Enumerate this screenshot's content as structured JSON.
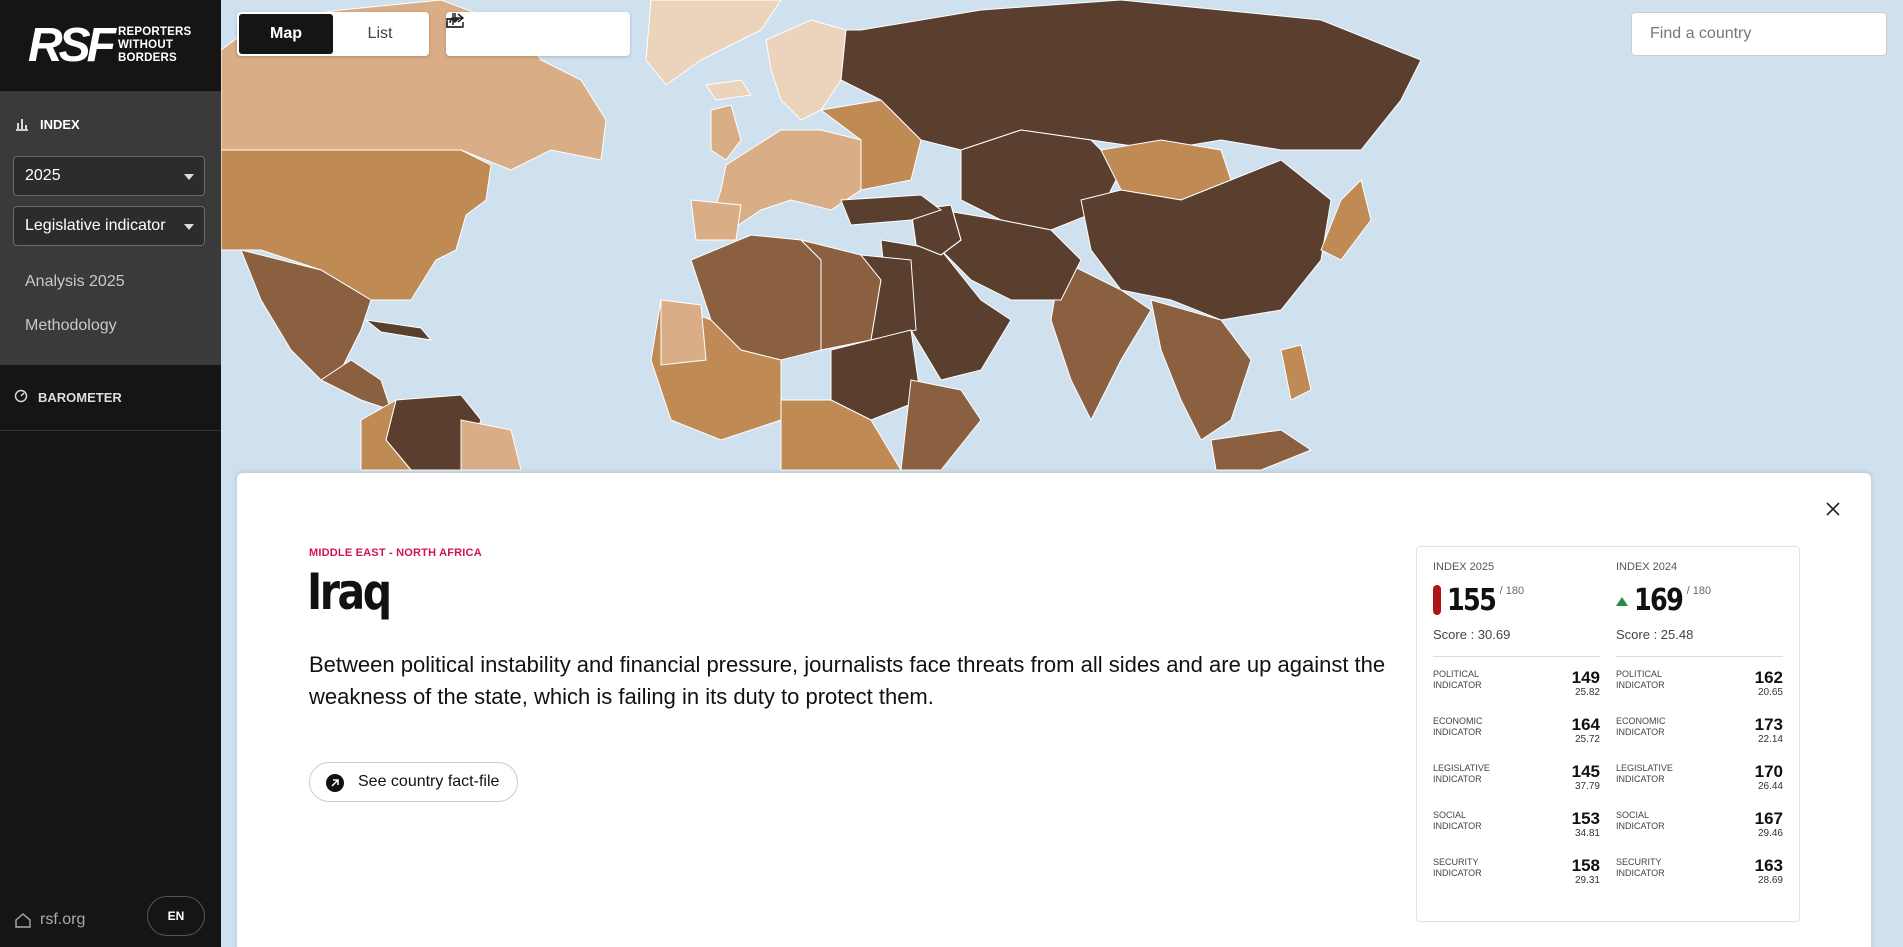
{
  "sidebar": {
    "logo_mark": "RSF",
    "logo_line1": "REPORTERS",
    "logo_line2": "WITHOUT BORDERS",
    "index_label": "INDEX",
    "year_select": "2025",
    "indicator_select": "Legislative indicator",
    "links": [
      "Analysis 2025",
      "Methodology"
    ],
    "barometer_label": "BAROMETER",
    "site_link": "rsf.org",
    "language": "EN"
  },
  "toolbar": {
    "map_label": "Map",
    "list_label": "List",
    "active_view": "Map",
    "tools": [
      "zoom-in-icon",
      "zoom-out-icon",
      "download-icon",
      "share-icon"
    ]
  },
  "search": {
    "placeholder": "Find a country"
  },
  "colors": {
    "ocean": "#cfe0ee",
    "very_serious": "#5a3f2e",
    "difficult": "#8a6040",
    "problematic": "#c08a55",
    "satisfactory": "#d9ad85",
    "good": "#ecd3bb",
    "accent_red": "#d0144f"
  },
  "country": {
    "region": "MIDDLE EAST - NORTH AFRICA",
    "name": "Iraq",
    "description": "Between political instability and financial pressure, journalists face threats from all sides and are up against the weakness of the state, which is failing in its duty to protect them.",
    "factfile_label": "See country fact-file"
  },
  "scorecard": [
    {
      "title": "INDEX 2025",
      "rank": "155",
      "of": "/ 180",
      "trend": "red-bar",
      "score": "Score : 30.69",
      "indicators": [
        {
          "label1": "POLITICAL",
          "label2": "INDICATOR",
          "rank": "149",
          "score": "25.82"
        },
        {
          "label1": "ECONOMIC",
          "label2": "INDICATOR",
          "rank": "164",
          "score": "25.72"
        },
        {
          "label1": "LEGISLATIVE",
          "label2": "INDICATOR",
          "rank": "145",
          "score": "37.79"
        },
        {
          "label1": "SOCIAL",
          "label2": "INDICATOR",
          "rank": "153",
          "score": "34.81"
        },
        {
          "label1": "SECURITY",
          "label2": "INDICATOR",
          "rank": "158",
          "score": "29.31"
        }
      ]
    },
    {
      "title": "INDEX 2024",
      "rank": "169",
      "of": "/ 180",
      "trend": "up-arrow",
      "score": "Score : 25.48",
      "indicators": [
        {
          "label1": "POLITICAL",
          "label2": "INDICATOR",
          "rank": "162",
          "score": "20.65"
        },
        {
          "label1": "ECONOMIC",
          "label2": "INDICATOR",
          "rank": "173",
          "score": "22.14"
        },
        {
          "label1": "LEGISLATIVE",
          "label2": "INDICATOR",
          "rank": "170",
          "score": "26.44"
        },
        {
          "label1": "SOCIAL",
          "label2": "INDICATOR",
          "rank": "167",
          "score": "29.46"
        },
        {
          "label1": "SECURITY",
          "label2": "INDICATOR",
          "rank": "163",
          "score": "28.69"
        }
      ]
    }
  ]
}
